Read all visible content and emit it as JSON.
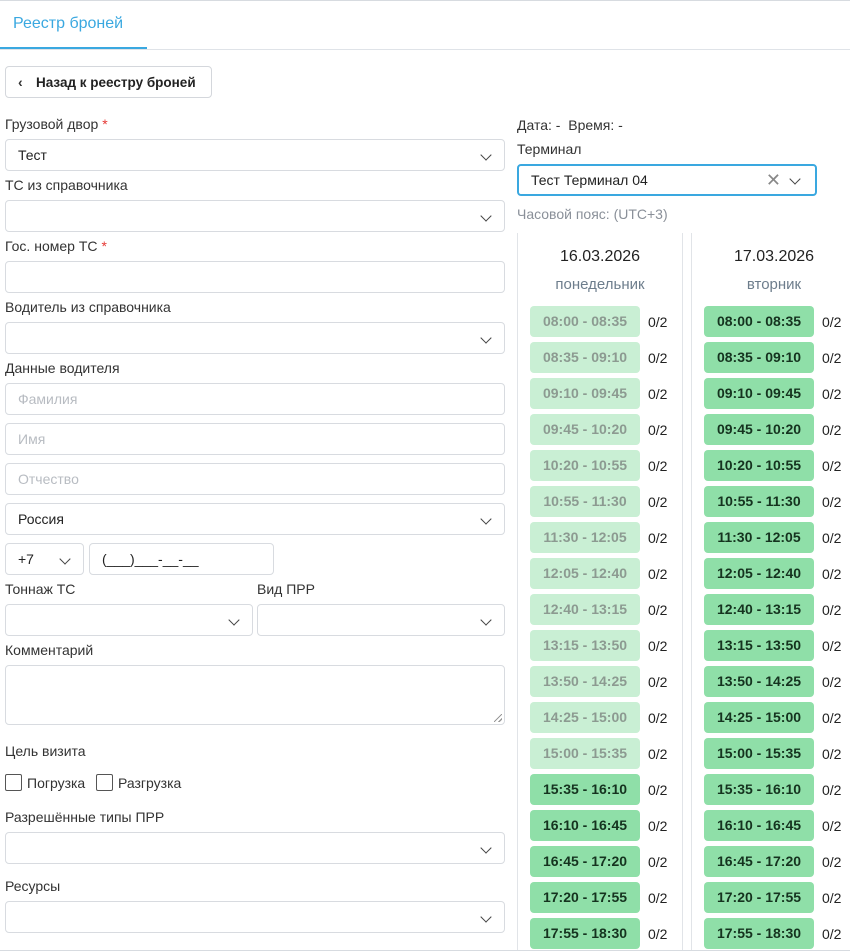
{
  "tab": {
    "label": "Реестр броней"
  },
  "back_button": {
    "label": "Назад к реестру броней"
  },
  "form": {
    "cargo_yard": {
      "label": "Грузовой двор",
      "value": "Тест"
    },
    "vehicle_ref": {
      "label": "ТС из справочника",
      "value": ""
    },
    "plate": {
      "label": "Гос. номер ТС",
      "value": ""
    },
    "driver_ref": {
      "label": "Водитель из справочника",
      "value": ""
    },
    "driver_data": {
      "label": "Данные водителя",
      "last_name_placeholder": "Фамилия",
      "first_name_placeholder": "Имя",
      "middle_name_placeholder": "Отчество",
      "country": "Россия",
      "phone_code": "+7",
      "phone_mask": "(___)___-__-__"
    },
    "tonnage": {
      "label": "Тоннаж ТС",
      "value": ""
    },
    "ppr_type": {
      "label": "Вид ПРР",
      "value": ""
    },
    "comment": {
      "label": "Комментарий",
      "value": ""
    },
    "visit_goal": {
      "label": "Цель визита",
      "options": [
        "Погрузка",
        "Разгрузка"
      ]
    },
    "allowed_ppr": {
      "label": "Разрешённые типы ПРР",
      "value": ""
    },
    "resources": {
      "label": "Ресурсы",
      "value": ""
    },
    "required_mark": "*"
  },
  "schedule": {
    "date_label": "Дата:",
    "date_value": "-",
    "time_label": "Время:",
    "time_value": "-",
    "terminal_label": "Терминал",
    "terminal_value": "Тест Терминал 04",
    "timezone": "Часовой пояс: (UTC+3)",
    "days": [
      {
        "date": "16.03.2026",
        "weekday": "понедельник",
        "slots": [
          {
            "time": "08:00 - 08:35",
            "count": "0/2",
            "available": false
          },
          {
            "time": "08:35 - 09:10",
            "count": "0/2",
            "available": false
          },
          {
            "time": "09:10 - 09:45",
            "count": "0/2",
            "available": false
          },
          {
            "time": "09:45 - 10:20",
            "count": "0/2",
            "available": false
          },
          {
            "time": "10:20 - 10:55",
            "count": "0/2",
            "available": false
          },
          {
            "time": "10:55 - 11:30",
            "count": "0/2",
            "available": false
          },
          {
            "time": "11:30 - 12:05",
            "count": "0/2",
            "available": false
          },
          {
            "time": "12:05 - 12:40",
            "count": "0/2",
            "available": false
          },
          {
            "time": "12:40 - 13:15",
            "count": "0/2",
            "available": false
          },
          {
            "time": "13:15 - 13:50",
            "count": "0/2",
            "available": false
          },
          {
            "time": "13:50 - 14:25",
            "count": "0/2",
            "available": false
          },
          {
            "time": "14:25 - 15:00",
            "count": "0/2",
            "available": false
          },
          {
            "time": "15:00 - 15:35",
            "count": "0/2",
            "available": false
          },
          {
            "time": "15:35 - 16:10",
            "count": "0/2",
            "available": true
          },
          {
            "time": "16:10 - 16:45",
            "count": "0/2",
            "available": true
          },
          {
            "time": "16:45 - 17:20",
            "count": "0/2",
            "available": true
          },
          {
            "time": "17:20 - 17:55",
            "count": "0/2",
            "available": true
          },
          {
            "time": "17:55 - 18:30",
            "count": "0/2",
            "available": true
          }
        ]
      },
      {
        "date": "17.03.2026",
        "weekday": "вторник",
        "slots": [
          {
            "time": "08:00 - 08:35",
            "count": "0/2",
            "available": true
          },
          {
            "time": "08:35 - 09:10",
            "count": "0/2",
            "available": true
          },
          {
            "time": "09:10 - 09:45",
            "count": "0/2",
            "available": true
          },
          {
            "time": "09:45 - 10:20",
            "count": "0/2",
            "available": true
          },
          {
            "time": "10:20 - 10:55",
            "count": "0/2",
            "available": true
          },
          {
            "time": "10:55 - 11:30",
            "count": "0/2",
            "available": true
          },
          {
            "time": "11:30 - 12:05",
            "count": "0/2",
            "available": true
          },
          {
            "time": "12:05 - 12:40",
            "count": "0/2",
            "available": true
          },
          {
            "time": "12:40 - 13:15",
            "count": "0/2",
            "available": true
          },
          {
            "time": "13:15 - 13:50",
            "count": "0/2",
            "available": true
          },
          {
            "time": "13:50 - 14:25",
            "count": "0/2",
            "available": true
          },
          {
            "time": "14:25 - 15:00",
            "count": "0/2",
            "available": true
          },
          {
            "time": "15:00 - 15:35",
            "count": "0/2",
            "available": true
          },
          {
            "time": "15:35 - 16:10",
            "count": "0/2",
            "available": true
          },
          {
            "time": "16:10 - 16:45",
            "count": "0/2",
            "available": true
          },
          {
            "time": "16:45 - 17:20",
            "count": "0/2",
            "available": true
          },
          {
            "time": "17:20 - 17:55",
            "count": "0/2",
            "available": true
          },
          {
            "time": "17:55 - 18:30",
            "count": "0/2",
            "available": true
          }
        ]
      }
    ]
  }
}
